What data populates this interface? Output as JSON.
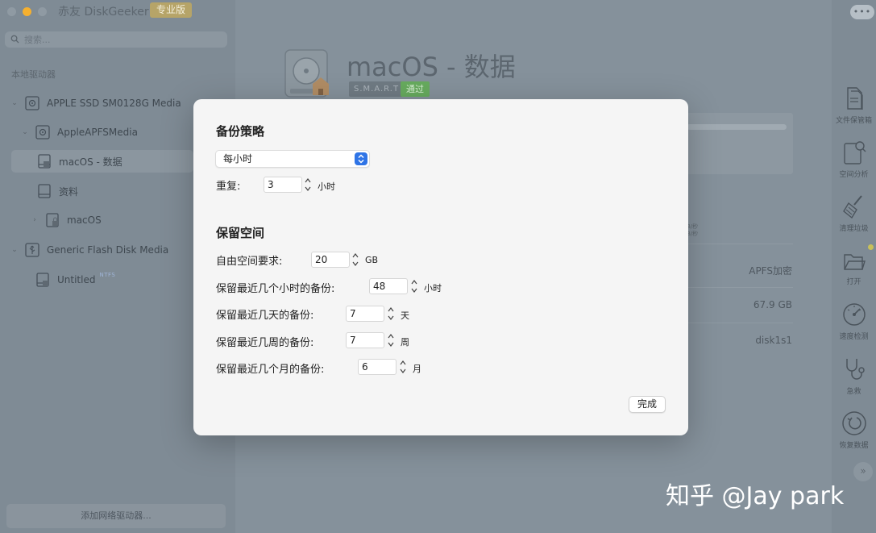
{
  "window": {
    "app_title": "赤友 DiskGeeker",
    "pro_badge": "专业版",
    "more_label": "•••"
  },
  "sidebar": {
    "search_placeholder": "搜索...",
    "section_label": "本地驱动器",
    "items": [
      {
        "label": "APPLE SSD SM0128G Media",
        "icon": "internal-disk-icon"
      },
      {
        "label": "AppleAPFSMedia",
        "icon": "apfs-container-icon"
      },
      {
        "label": "macOS - 数据",
        "icon": "volume-icon",
        "selected": true
      },
      {
        "label": "资料",
        "icon": "volume-icon"
      },
      {
        "label": "macOS",
        "icon": "locked-volume-icon"
      },
      {
        "label": "Generic Flash Disk Media",
        "icon": "usb-icon"
      },
      {
        "label": "Untitled",
        "icon": "external-volume-icon",
        "badge": "NTFS"
      }
    ],
    "add_network_label": "添加网络驱动器..."
  },
  "main": {
    "title": "macOS - 数据",
    "smart_label": "S.M.A.R.T",
    "smart_status": "通过",
    "speed_read": "B/秒",
    "speed_write": "B/秒",
    "info_values": [
      "APFS加密",
      "67.9 GB",
      "disk1s1"
    ]
  },
  "toolbar": {
    "items": [
      {
        "label": "文件保管箱",
        "icon": "file-vault-icon"
      },
      {
        "label": "空间分析",
        "icon": "space-analysis-icon"
      },
      {
        "label": "清理垃圾",
        "icon": "broom-icon"
      },
      {
        "label": "打开",
        "icon": "folder-open-icon"
      },
      {
        "label": "速度检测",
        "icon": "speedometer-icon"
      },
      {
        "label": "急救",
        "icon": "stethoscope-icon"
      },
      {
        "label": "恢复数据",
        "icon": "restore-icon"
      }
    ],
    "expand_label": "»"
  },
  "dialog": {
    "backup_heading": "备份策略",
    "strategy_value": "每小时",
    "repeat_label": "重复:",
    "repeat_value": "3",
    "repeat_unit": "小时",
    "reserve_heading": "保留空间",
    "fields": [
      {
        "label": "自由空间要求:",
        "value": "20",
        "unit": "GB"
      },
      {
        "label": "保留最近几个小时的备份:",
        "value": "48",
        "unit": "小时"
      },
      {
        "label": "保留最近几天的备份:",
        "value": "7",
        "unit": "天"
      },
      {
        "label": "保留最近几周的备份:",
        "value": "7",
        "unit": "周"
      },
      {
        "label": "保留最近几个月的备份:",
        "value": "6",
        "unit": "月"
      }
    ],
    "done_label": "完成"
  },
  "watermark": "知乎 @Jay park"
}
